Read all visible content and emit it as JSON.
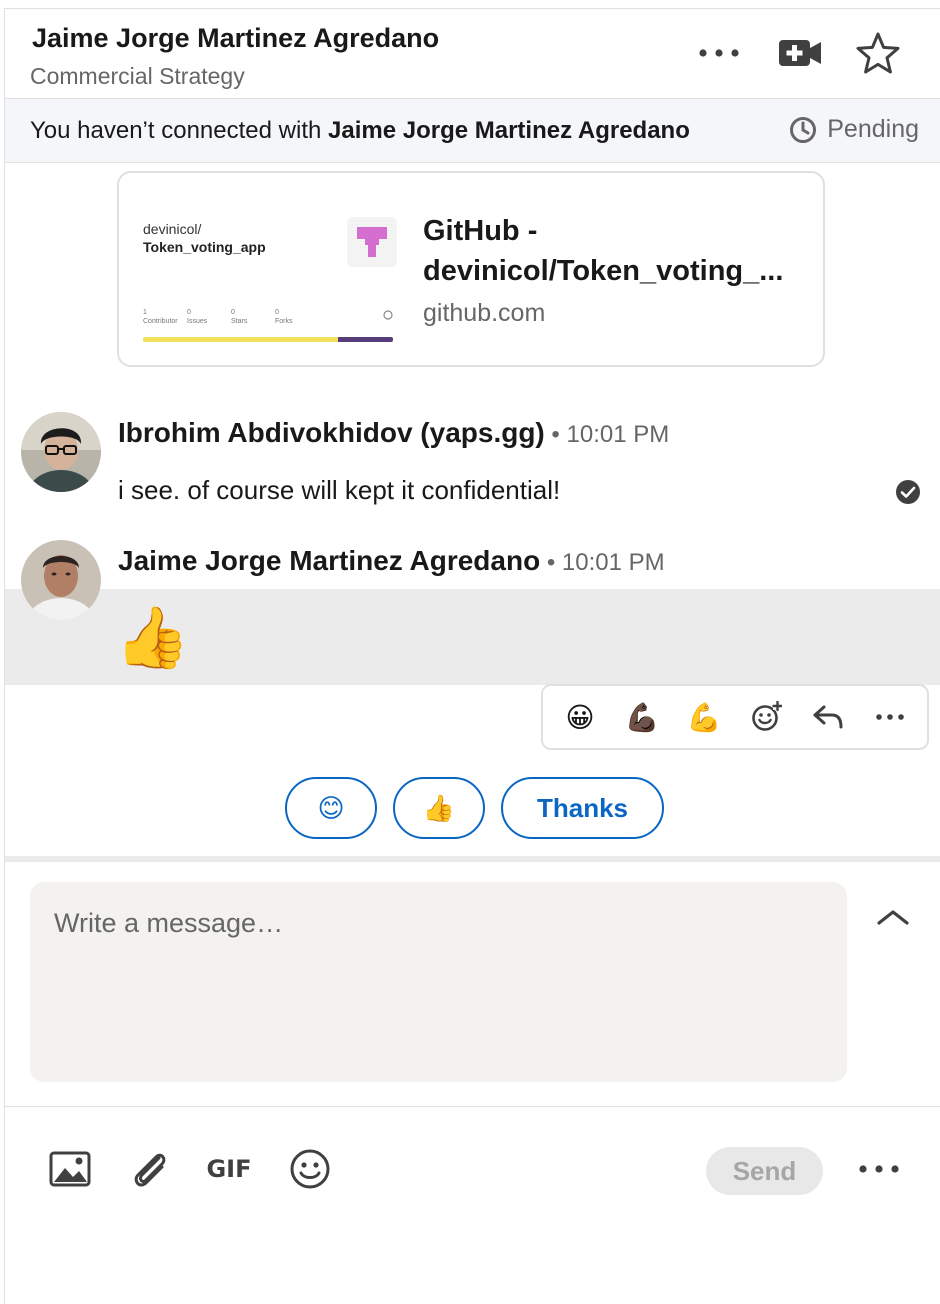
{
  "header": {
    "contact_name": "Jaime Jorge Martinez Agredano",
    "contact_headline": "Commercial Strategy",
    "icons": [
      "more-icon",
      "video-call-icon",
      "star-icon"
    ]
  },
  "banner": {
    "prefix": "You haven’t connected with ",
    "name": "Jaime Jorge Martinez Agredano",
    "status": "Pending"
  },
  "link_preview": {
    "repo_owner": "devinicol/",
    "repo_name": "Token_voting_app",
    "stats": [
      {
        "count": "1",
        "label": "Contributor"
      },
      {
        "count": "0",
        "label": "Issues"
      },
      {
        "count": "0",
        "label": "Stars"
      },
      {
        "count": "0",
        "label": "Forks"
      }
    ],
    "title": "GitHub - devinicol/Token_voting_...",
    "domain": "github.com"
  },
  "messages": [
    {
      "sender": "Ibrohim Abdivokhidov (yaps.gg)",
      "time": " • 10:01 PM",
      "text": "i see. of course will kept it confidential!"
    },
    {
      "sender": "Jaime Jorge Martinez Agredano",
      "time": " • 10:01 PM",
      "text": "👍"
    }
  ],
  "reactions": [
    "😀",
    "💪🏿",
    "💪",
    "add-reaction-icon",
    "reply-icon",
    "more-icon"
  ],
  "suggested_replies": [
    "😊",
    "👍",
    "Thanks"
  ],
  "compose": {
    "placeholder": "Write a message…",
    "send_label": "Send",
    "gif_label": "GIF"
  },
  "colors": {
    "accent": "#0a66c2",
    "banner_bg": "#f4f6f9",
    "compose_bg": "#f3f2ef",
    "highlight_bg": "#ebebeb"
  }
}
